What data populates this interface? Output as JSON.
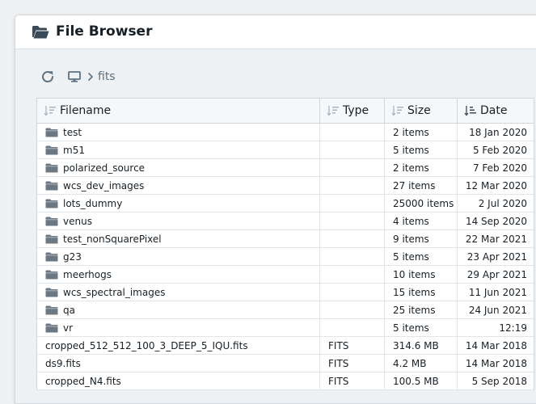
{
  "dialog": {
    "title": "File Browser",
    "header_icon": "folder-open-icon"
  },
  "toolbar": {
    "refresh_icon": "refresh-icon",
    "computer_icon": "desktop-icon",
    "separator_icon": "chevron-right-icon",
    "breadcrumb": [
      "fits"
    ]
  },
  "table": {
    "columns": {
      "name": "Filename",
      "type": "Type",
      "size": "Size",
      "date": "Date"
    },
    "rows": [
      {
        "kind": "folder",
        "name": "test",
        "type": "",
        "size": "2 items",
        "date": "18 Jan 2020"
      },
      {
        "kind": "folder",
        "name": "m51",
        "type": "",
        "size": "5 items",
        "date": "5 Feb 2020"
      },
      {
        "kind": "folder",
        "name": "polarized_source",
        "type": "",
        "size": "2 items",
        "date": "7 Feb 2020"
      },
      {
        "kind": "folder",
        "name": "wcs_dev_images",
        "type": "",
        "size": "27 items",
        "date": "12 Mar 2020"
      },
      {
        "kind": "folder",
        "name": "lots_dummy",
        "type": "",
        "size": "25000 items",
        "date": "2 Jul 2020"
      },
      {
        "kind": "folder",
        "name": "venus",
        "type": "",
        "size": "4 items",
        "date": "14 Sep 2020"
      },
      {
        "kind": "folder",
        "name": "test_nonSquarePixel",
        "type": "",
        "size": "9 items",
        "date": "22 Mar 2021"
      },
      {
        "kind": "folder",
        "name": "g23",
        "type": "",
        "size": "5 items",
        "date": "23 Apr 2021"
      },
      {
        "kind": "folder",
        "name": "meerhogs",
        "type": "",
        "size": "10 items",
        "date": "29 Apr 2021"
      },
      {
        "kind": "folder",
        "name": "wcs_spectral_images",
        "type": "",
        "size": "15 items",
        "date": "11 Jun 2021"
      },
      {
        "kind": "folder",
        "name": "qa",
        "type": "",
        "size": "25 items",
        "date": "24 Jun 2021"
      },
      {
        "kind": "folder",
        "name": "vr",
        "type": "",
        "size": "5 items",
        "date": "12:19"
      },
      {
        "kind": "file",
        "name": "cropped_512_512_100_3_DEEP_5_IQU.fits",
        "type": "FITS",
        "size": "314.6 MB",
        "date": "14 Mar 2018"
      },
      {
        "kind": "file",
        "name": "ds9.fits",
        "type": "FITS",
        "size": "4.2 MB",
        "date": "14 Mar 2018"
      },
      {
        "kind": "file",
        "name": "cropped_N4.fits",
        "type": "FITS",
        "size": "100.5 MB",
        "date": "5 Sep 2018"
      }
    ]
  },
  "colors": {
    "folder_icon": "#6b7781",
    "text": "#182026",
    "muted": "#5c7080",
    "header_bg": "#f5f8fa",
    "body_bg": "#edf1f4"
  }
}
